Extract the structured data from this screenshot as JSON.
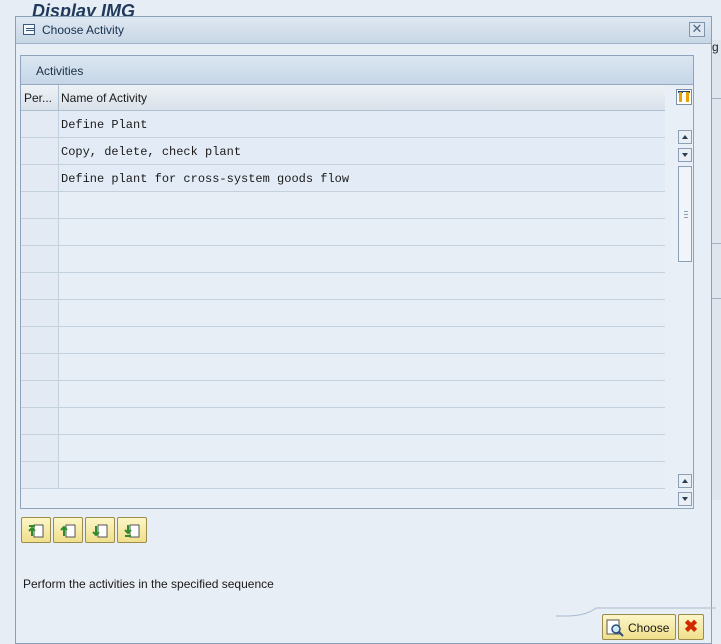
{
  "background": {
    "title": "Display IMG",
    "side_text": "g"
  },
  "dialog": {
    "title": "Choose Activity",
    "close_symbol": "✕",
    "panel_title": "Activities",
    "columns": {
      "perform": "Per...",
      "name": "Name of Activity"
    },
    "activities": [
      {
        "name": "Define Plant"
      },
      {
        "name": "Copy, delete, check plant"
      },
      {
        "name": "Define plant for cross-system goods flow"
      }
    ],
    "empty_row_count": 11,
    "sequence_buttons": [
      {
        "icon": "move-to-top-icon"
      },
      {
        "icon": "move-up-icon"
      },
      {
        "icon": "move-down-icon"
      },
      {
        "icon": "move-to-bottom-icon"
      }
    ],
    "hint": "Perform the activities in the specified sequence",
    "footer": {
      "choose_label": "Choose",
      "cancel_symbol": "✖"
    }
  }
}
